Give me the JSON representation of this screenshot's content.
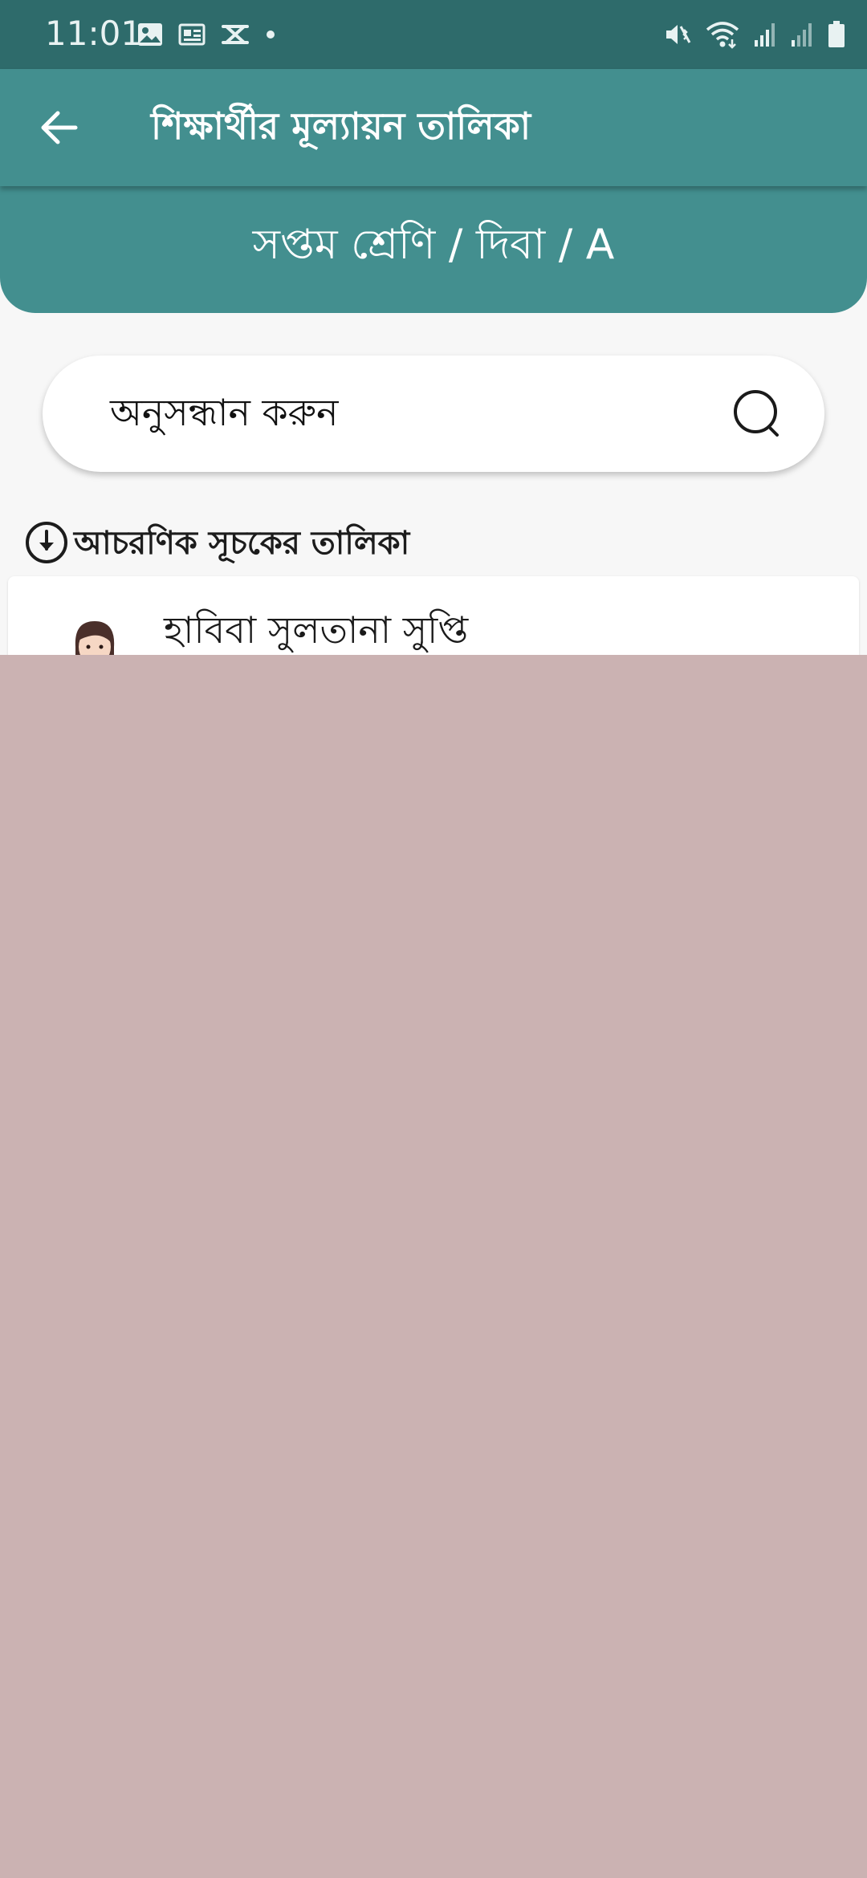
{
  "status_bar": {
    "time": "11:01",
    "left_icons": [
      "image-icon",
      "news-icon",
      "capcut-icon",
      "dot-icon"
    ],
    "right_icons": [
      "mute-vibrate-icon",
      "wifi-icon",
      "signal-1-icon",
      "signal-2-icon",
      "battery-icon"
    ]
  },
  "app_bar": {
    "title": "শিক্ষার্থীর মূল্যায়ন তালিকা",
    "back_icon": "back-arrow-icon"
  },
  "banner": {
    "class_label": "সপ্তম শ্রেণি / দিবা / A"
  },
  "search": {
    "placeholder": "অনুসন্ধান করুন",
    "icon": "search-icon"
  },
  "section": {
    "label": "আচরণিক সূচকের তালিকা",
    "icon": "download-icon"
  },
  "students": [
    {
      "name": "হাবিবা সুলতানা সুপ্তি",
      "avatar": "female-avatar-icon"
    }
  ],
  "colors": {
    "status_bar": "#2e6b6b",
    "primary": "#438f8f",
    "background": "#f7f7f7",
    "overlay": "#cbb2b2"
  }
}
